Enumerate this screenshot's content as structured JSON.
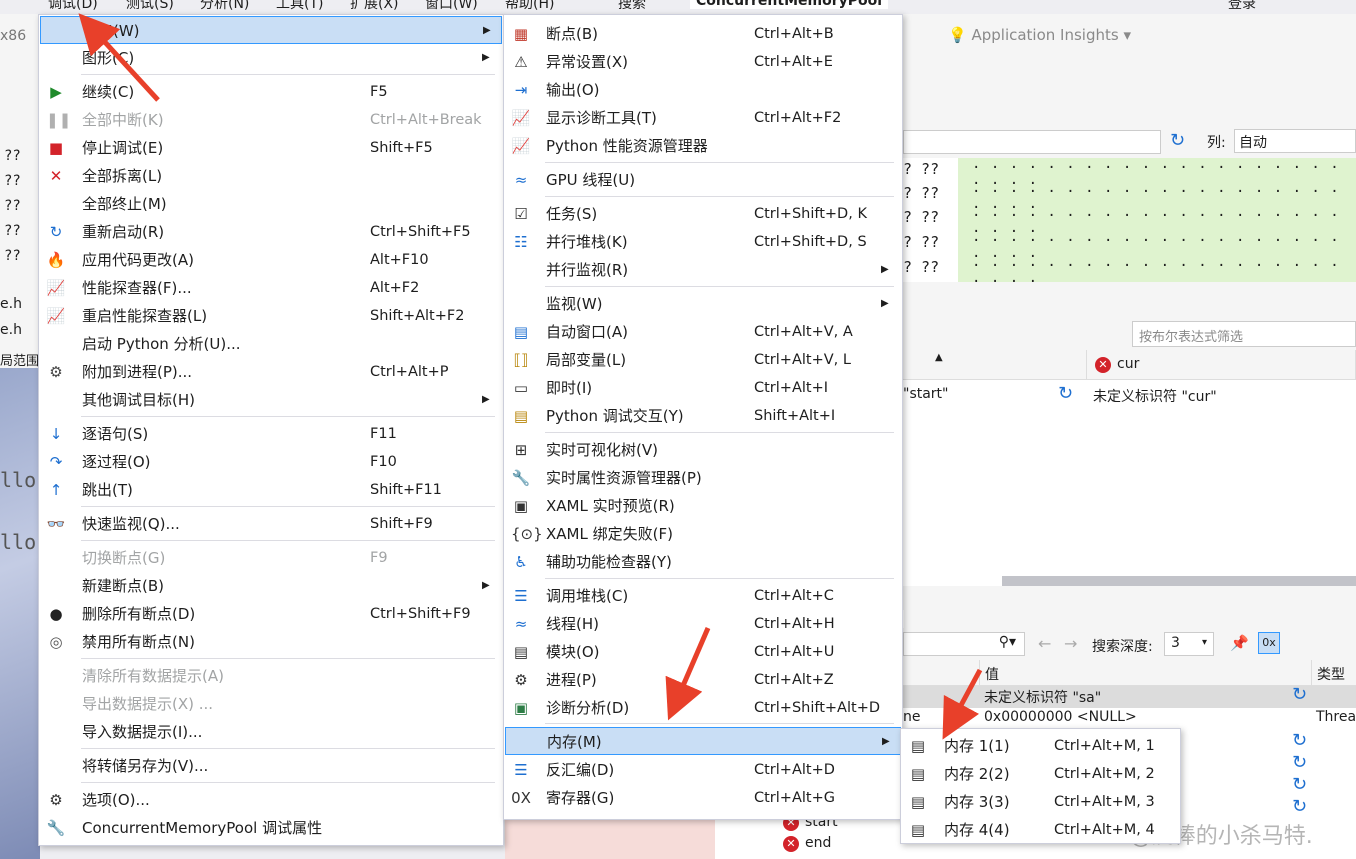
{
  "menubar": {
    "items": [
      "调试(D)",
      "测试(S)",
      "分析(N)",
      "工具(T)",
      "扩展(X)",
      "窗口(W)",
      "帮助(H)",
      "搜索"
    ],
    "title": "ConcurrentMemoryPool",
    "login": "登录"
  },
  "background": {
    "left_texts": [
      "x86",
      "?? ",
      "e.h",
      "e.h",
      "局范围",
      "lloc",
      "lloc"
    ],
    "app_insights": "Application Insights",
    "column_label": "列:",
    "column_value": "自动",
    "mem_marks": "? ??",
    "filter_placeholder": "按布尔表达式筛选",
    "watch_col_cur": "cur",
    "watch_val_start": "\"start\"",
    "watch_val_cur": "未定义标识符 \"cur\"",
    "search_depth_label": "搜索深度:",
    "search_depth_value": "3",
    "locals_col_value": "值",
    "locals_col_type": "类型",
    "locals_rows": [
      {
        "name": "",
        "value": "未定义标识符 \"sa\"",
        "type": ""
      },
      {
        "name": "ne",
        "value": "0x00000000 <NULL>",
        "type": "Threa"
      }
    ],
    "locals_bottom": [
      "start",
      "end"
    ],
    "watermark": "CSDN @爱棒的小杀马特."
  },
  "debug_menu": {
    "items": [
      {
        "icon": "",
        "label": "窗口(W)",
        "shortcut": "",
        "submenu": true,
        "selected": true
      },
      {
        "icon": "",
        "label": "图形(C)",
        "shortcut": "",
        "submenu": true
      },
      {
        "icon": "continue-icon",
        "label": "继续(C)",
        "shortcut": "F5"
      },
      {
        "icon": "pause-icon",
        "label": "全部中断(K)",
        "shortcut": "Ctrl+Alt+Break",
        "disabled": true
      },
      {
        "icon": "stop-icon",
        "label": "停止调试(E)",
        "shortcut": "Shift+F5"
      },
      {
        "icon": "detach-icon",
        "label": "全部拆离(L)",
        "shortcut": ""
      },
      {
        "icon": "",
        "label": "全部终止(M)",
        "shortcut": ""
      },
      {
        "icon": "restart-icon",
        "label": "重新启动(R)",
        "shortcut": "Ctrl+Shift+F5"
      },
      {
        "icon": "hot-reload-icon",
        "label": "应用代码更改(A)",
        "shortcut": "Alt+F10"
      },
      {
        "icon": "profiler-icon",
        "label": "性能探查器(F)...",
        "shortcut": "Alt+F2"
      },
      {
        "icon": "profiler-restart-icon",
        "label": "重启性能探查器(L)",
        "shortcut": "Shift+Alt+F2"
      },
      {
        "icon": "",
        "label": "启动 Python 分析(U)...",
        "shortcut": ""
      },
      {
        "icon": "attach-process-icon",
        "label": "附加到进程(P)...",
        "shortcut": "Ctrl+Alt+P"
      },
      {
        "icon": "",
        "label": "其他调试目标(H)",
        "shortcut": "",
        "submenu": true
      },
      {
        "icon": "step-into-icon",
        "label": "逐语句(S)",
        "shortcut": "F11"
      },
      {
        "icon": "step-over-icon",
        "label": "逐过程(O)",
        "shortcut": "F10"
      },
      {
        "icon": "step-out-icon",
        "label": "跳出(T)",
        "shortcut": "Shift+F11"
      },
      {
        "icon": "quick-watch-icon",
        "label": "快速监视(Q)...",
        "shortcut": "Shift+F9"
      },
      {
        "icon": "",
        "label": "切换断点(G)",
        "shortcut": "F9",
        "disabled": true
      },
      {
        "icon": "",
        "label": "新建断点(B)",
        "shortcut": "",
        "submenu": true
      },
      {
        "icon": "delete-breakpoints-icon",
        "label": "删除所有断点(D)",
        "shortcut": "Ctrl+Shift+F9"
      },
      {
        "icon": "disable-breakpoints-icon",
        "label": "禁用所有断点(N)",
        "shortcut": ""
      },
      {
        "icon": "",
        "label": "清除所有数据提示(A)",
        "shortcut": "",
        "disabled": true
      },
      {
        "icon": "",
        "label": "导出数据提示(X) ...",
        "shortcut": "",
        "disabled": true
      },
      {
        "icon": "",
        "label": "导入数据提示(I)...",
        "shortcut": ""
      },
      {
        "icon": "",
        "label": "将转储另存为(V)...",
        "shortcut": ""
      },
      {
        "icon": "gear-icon",
        "label": "选项(O)...",
        "shortcut": ""
      },
      {
        "icon": "wrench-icon",
        "label": "ConcurrentMemoryPool 调试属性",
        "shortcut": ""
      }
    ]
  },
  "window_menu": {
    "items": [
      {
        "icon": "breakpoints-icon",
        "label": "断点(B)",
        "shortcut": "Ctrl+Alt+B"
      },
      {
        "icon": "exception-settings-icon",
        "label": "异常设置(X)",
        "shortcut": "Ctrl+Alt+E"
      },
      {
        "icon": "output-icon",
        "label": "输出(O)",
        "shortcut": ""
      },
      {
        "icon": "diagnostic-tools-icon",
        "label": "显示诊断工具(T)",
        "shortcut": "Ctrl+Alt+F2"
      },
      {
        "icon": "python-profiler-icon",
        "label": "Python 性能资源管理器",
        "shortcut": ""
      },
      {
        "icon": "gpu-threads-icon",
        "label": "GPU 线程(U)",
        "shortcut": ""
      },
      {
        "icon": "tasks-icon",
        "label": "任务(S)",
        "shortcut": "Ctrl+Shift+D, K"
      },
      {
        "icon": "parallel-stacks-icon",
        "label": "并行堆栈(K)",
        "shortcut": "Ctrl+Shift+D, S"
      },
      {
        "icon": "",
        "label": "并行监视(R)",
        "shortcut": "",
        "submenu": true
      },
      {
        "icon": "",
        "label": "监视(W)",
        "shortcut": "",
        "submenu": true
      },
      {
        "icon": "autos-icon",
        "label": "自动窗口(A)",
        "shortcut": "Ctrl+Alt+V, A"
      },
      {
        "icon": "locals-icon",
        "label": "局部变量(L)",
        "shortcut": "Ctrl+Alt+V, L"
      },
      {
        "icon": "immediate-icon",
        "label": "即时(I)",
        "shortcut": "Ctrl+Alt+I"
      },
      {
        "icon": "python-interactive-icon",
        "label": "Python 调试交互(Y)",
        "shortcut": "Shift+Alt+I"
      },
      {
        "icon": "live-visual-tree-icon",
        "label": "实时可视化树(V)",
        "shortcut": ""
      },
      {
        "icon": "live-property-icon",
        "label": "实时属性资源管理器(P)",
        "shortcut": ""
      },
      {
        "icon": "xaml-preview-icon",
        "label": "XAML 实时预览(R)",
        "shortcut": ""
      },
      {
        "icon": "xaml-binding-icon",
        "label": "XAML 绑定失败(F)",
        "shortcut": ""
      },
      {
        "icon": "accessibility-icon",
        "label": "辅助功能检查器(Y)",
        "shortcut": ""
      },
      {
        "icon": "call-stack-icon",
        "label": "调用堆栈(C)",
        "shortcut": "Ctrl+Alt+C"
      },
      {
        "icon": "threads-icon",
        "label": "线程(H)",
        "shortcut": "Ctrl+Alt+H"
      },
      {
        "icon": "modules-icon",
        "label": "模块(O)",
        "shortcut": "Ctrl+Alt+U"
      },
      {
        "icon": "processes-icon",
        "label": "进程(P)",
        "shortcut": "Ctrl+Alt+Z"
      },
      {
        "icon": "diagnostic-analysis-icon",
        "label": "诊断分析(D)",
        "shortcut": "Ctrl+Shift+Alt+D"
      },
      {
        "icon": "",
        "label": "内存(M)",
        "shortcut": "",
        "submenu": true,
        "selected": true
      },
      {
        "icon": "disassembly-icon",
        "label": "反汇编(D)",
        "shortcut": "Ctrl+Alt+D"
      },
      {
        "icon": "registers-icon",
        "label": "寄存器(G)",
        "shortcut": "Ctrl+Alt+G"
      }
    ]
  },
  "memory_menu": {
    "items": [
      {
        "icon": "memory-icon",
        "label": "内存 1(1)",
        "shortcut": "Ctrl+Alt+M, 1"
      },
      {
        "icon": "memory-icon",
        "label": "内存 2(2)",
        "shortcut": "Ctrl+Alt+M, 2"
      },
      {
        "icon": "memory-icon",
        "label": "内存 3(3)",
        "shortcut": "Ctrl+Alt+M, 3"
      },
      {
        "icon": "memory-icon",
        "label": "内存 4(4)",
        "shortcut": "Ctrl+Alt+M, 4"
      }
    ]
  },
  "colors": {
    "accent": "#3399ff",
    "selection": "#c9def5",
    "annotation_arrow": "#e8402a",
    "error": "#d3232a"
  }
}
